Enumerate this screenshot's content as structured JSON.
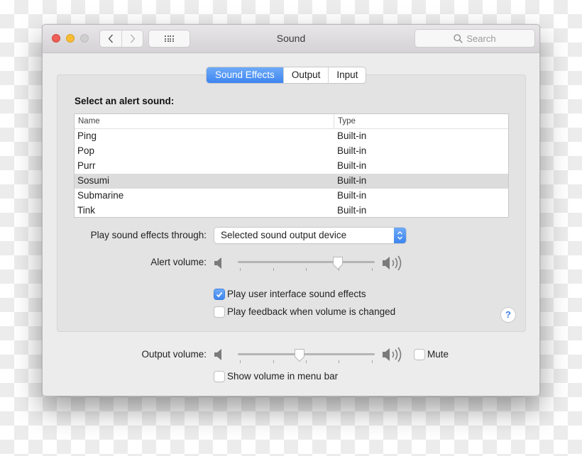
{
  "window": {
    "title": "Sound",
    "search_placeholder": "Search",
    "nav": {
      "back_icon": "chevron-left-icon",
      "forward_icon": "chevron-right-icon",
      "grid_icon": "show-all-grid-icon"
    }
  },
  "tabs": [
    {
      "label": "Sound Effects",
      "active": true
    },
    {
      "label": "Output",
      "active": false
    },
    {
      "label": "Input",
      "active": false
    }
  ],
  "sound_effects": {
    "section_label": "Select an alert sound:",
    "columns": [
      "Name",
      "Type"
    ],
    "rows": [
      {
        "name": "Ping",
        "type": "Built-in",
        "selected": false
      },
      {
        "name": "Pop",
        "type": "Built-in",
        "selected": false
      },
      {
        "name": "Purr",
        "type": "Built-in",
        "selected": false
      },
      {
        "name": "Sosumi",
        "type": "Built-in",
        "selected": true
      },
      {
        "name": "Submarine",
        "type": "Built-in",
        "selected": false
      },
      {
        "name": "Tink",
        "type": "Built-in",
        "selected": false
      }
    ],
    "play_through_label": "Play sound effects through:",
    "play_through_value": "Selected sound output device",
    "alert_volume_label": "Alert volume:",
    "alert_volume_fraction": 0.73,
    "checkboxes": [
      {
        "label": "Play user interface sound effects",
        "checked": true
      },
      {
        "label": "Play feedback when volume is changed",
        "checked": false
      }
    ],
    "help_label": "?"
  },
  "output": {
    "volume_label": "Output volume:",
    "volume_fraction": 0.45,
    "mute_label": "Mute",
    "mute_checked": false,
    "menu_bar_label": "Show volume in menu bar",
    "menu_bar_checked": false
  },
  "colors": {
    "accent": "#3d85f0",
    "close": "#ee5f58",
    "minimize": "#f8bd34",
    "zoom": "#d0cfd0"
  }
}
